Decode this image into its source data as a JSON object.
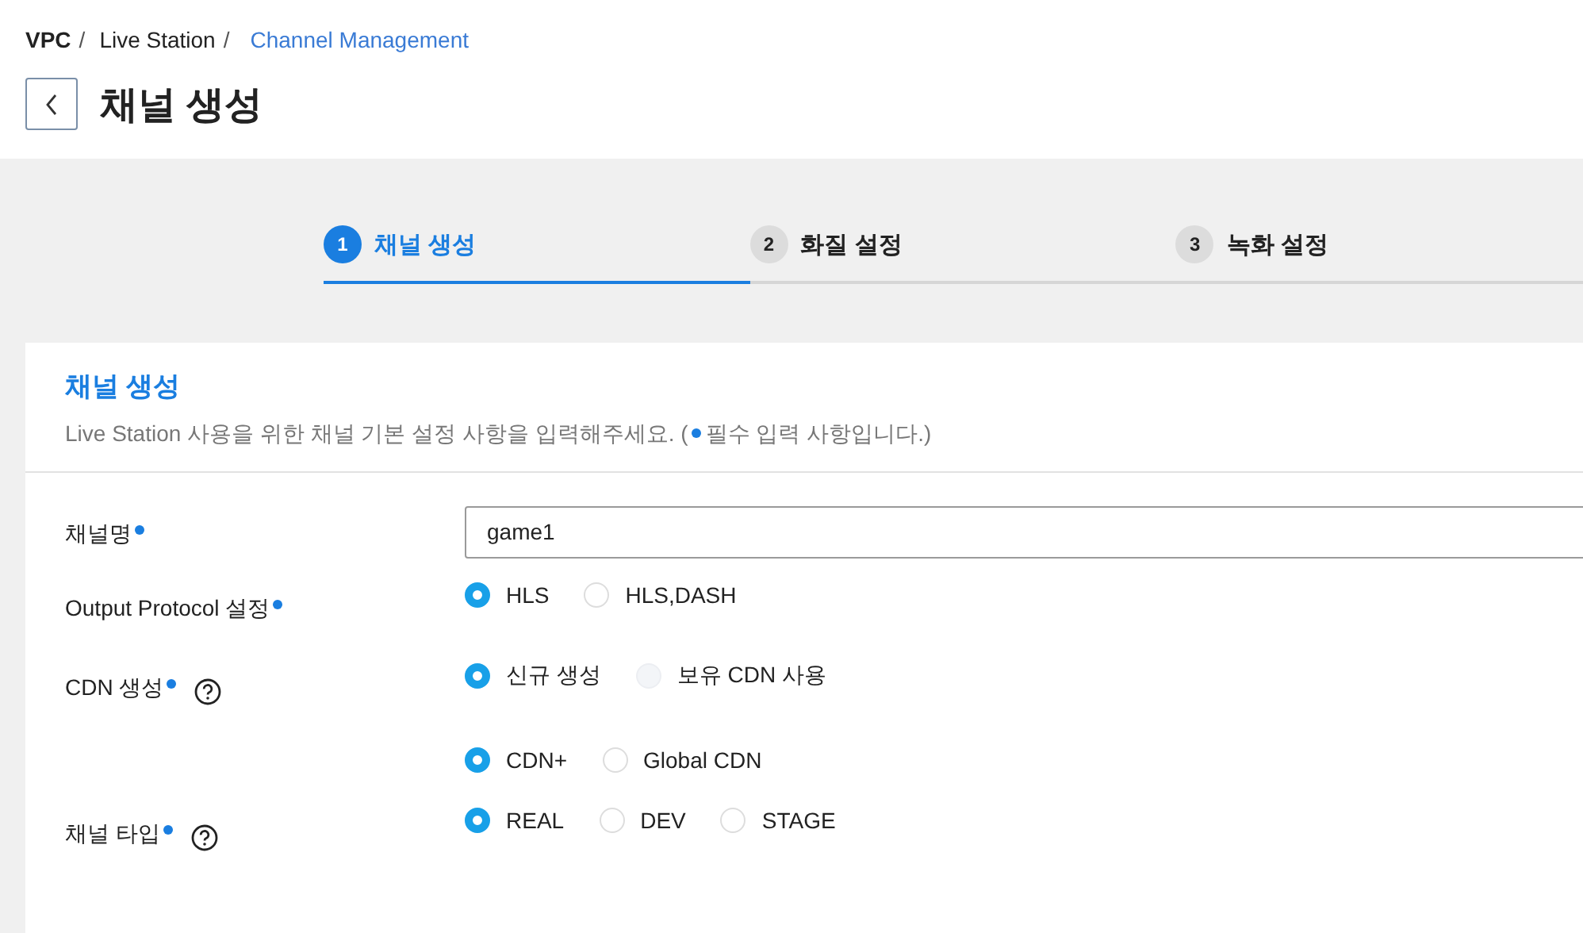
{
  "breadcrumb": [
    {
      "label": "VPC",
      "kind": "root",
      "separator": "/"
    },
    {
      "label": "Live Station",
      "kind": "plain",
      "separator": "/"
    },
    {
      "label": "Channel Management",
      "kind": "link"
    }
  ],
  "page_title": "채널 생성",
  "steps": [
    {
      "number": "1",
      "label": "채널 생성",
      "selected": true
    },
    {
      "number": "2",
      "label": "화질 설정",
      "selected": false
    },
    {
      "number": "3",
      "label": "녹화 설정",
      "selected": false
    }
  ],
  "section": {
    "title": "채널 생성",
    "description": "Live Station 사용을 위한 채널 기본 설정 사항을 입력해주세요. (",
    "required_note": "필수 입력 사항입니다.)"
  },
  "fields": [
    {
      "kind": "text",
      "label": "채널명",
      "required": true,
      "value": "game1"
    },
    {
      "kind": "radio",
      "label": "Output Protocol 설정",
      "required": true,
      "options": [
        {
          "label": "HLS",
          "selected": true,
          "disabled": false
        },
        {
          "label": "HLS,DASH",
          "selected": false,
          "disabled": false
        }
      ]
    },
    {
      "kind": "radio",
      "label": "CDN 생성",
      "required": true,
      "help": true,
      "options": [
        {
          "label": "신규 생성",
          "selected": true,
          "disabled": false
        },
        {
          "label": "보유 CDN 사용",
          "selected": false,
          "disabled": true
        }
      ]
    },
    {
      "kind": "radio",
      "options": [
        {
          "label": "CDN+",
          "selected": true,
          "disabled": false
        },
        {
          "label": "Global CDN",
          "selected": false,
          "disabled": false
        }
      ]
    },
    {
      "kind": "radio",
      "label": "채널 타입",
      "required": true,
      "help": true,
      "options": [
        {
          "label": "REAL",
          "selected": true,
          "disabled": false
        },
        {
          "label": "DEV",
          "selected": false,
          "disabled": false
        },
        {
          "label": "STAGE",
          "selected": false,
          "disabled": false
        }
      ]
    }
  ]
}
